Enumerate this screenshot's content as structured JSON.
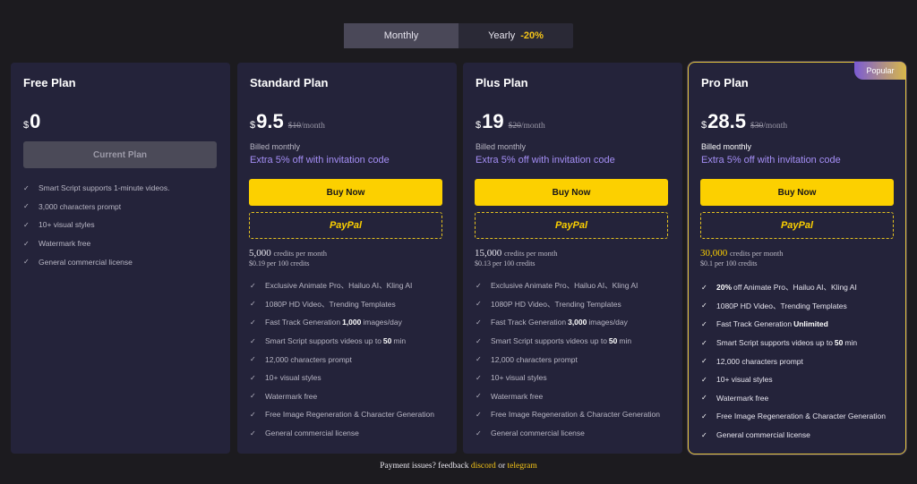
{
  "billing_toggle": {
    "monthly_label": "Monthly",
    "yearly_label": "Yearly",
    "yearly_discount": "-20%",
    "selected": "Monthly"
  },
  "currency_symbol": "$",
  "plans": [
    {
      "name": "Free Plan",
      "price": "0",
      "button_label": "Current Plan",
      "features": [
        "Smart Script supports 1-minute videos.",
        "3,000 characters prompt",
        "10+ visual styles",
        "Watermark free",
        "General commercial license"
      ]
    },
    {
      "name": "Standard Plan",
      "price": "9.5",
      "old_price": "$10",
      "old_period": "/month",
      "billed": "Billed monthly",
      "extra": "Extra 5% off with invitation code",
      "buy_label": "Buy Now",
      "paypal_label": "PayPal",
      "credits": "5,000",
      "credits_suffix": "credits per month",
      "credits_rate": "$0.19 per 100 credits",
      "features": {
        "f1": "Exclusive Animate Pro、Hailuo AI、Kling AI",
        "f2": "1080P HD Video、Trending Templates",
        "f3_pre": "Fast Track Generation",
        "f3_bold": "1,000",
        "f3_post": "images/day",
        "f4_pre": "Smart Script supports videos up to",
        "f4_bold": "50",
        "f4_post": "min",
        "f5": "12,000 characters prompt",
        "f6": "10+ visual styles",
        "f7": "Watermark free",
        "f8": "Free Image Regeneration & Character Generation",
        "f9": "General commercial license"
      }
    },
    {
      "name": "Plus Plan",
      "price": "19",
      "old_price": "$20",
      "old_period": "/month",
      "billed": "Billed monthly",
      "extra": "Extra 5% off with invitation code",
      "buy_label": "Buy Now",
      "paypal_label": "PayPal",
      "credits": "15,000",
      "credits_suffix": "credits per month",
      "credits_rate": "$0.13 per 100 credits",
      "features": {
        "f1": "Exclusive Animate Pro、Hailuo AI、Kling AI",
        "f2": "1080P HD Video、Trending Templates",
        "f3_pre": "Fast Track Generation",
        "f3_bold": "3,000",
        "f3_post": "images/day",
        "f4_pre": "Smart Script supports videos up to",
        "f4_bold": "50",
        "f4_post": "min",
        "f5": "12,000 characters prompt",
        "f6": "10+ visual styles",
        "f7": "Watermark free",
        "f8": "Free Image Regeneration & Character Generation",
        "f9": "General commercial license"
      }
    },
    {
      "name": "Pro Plan",
      "badge": "Popular",
      "price": "28.5",
      "old_price": "$30",
      "old_period": "/month",
      "billed": "Billed monthly",
      "extra": "Extra 5% off with invitation code",
      "buy_label": "Buy Now",
      "paypal_label": "PayPal",
      "credits": "30,000",
      "credits_suffix": "credits per month",
      "credits_rate": "$0.1 per 100 credits",
      "features": {
        "f1_bold": "20%",
        "f1_post": "off Animate Pro、Hailuo AI、Kling AI",
        "f2": "1080P HD Video、Trending Templates",
        "f3_pre": "Fast Track Generation",
        "f3_bold": "Unlimited",
        "f4_pre": "Smart Script supports videos up to",
        "f4_bold": "50",
        "f4_post": "min",
        "f5": "12,000 characters prompt",
        "f6": "10+ visual styles",
        "f7": "Watermark free",
        "f8": "Free Image Regeneration & Character Generation",
        "f9": "General commercial license"
      }
    }
  ],
  "footer": {
    "text": "Payment issues? feedback",
    "discord": "discord",
    "or": "or",
    "telegram": "telegram"
  },
  "colors": {
    "accent_yellow": "#fcd000",
    "accent_purple": "#a48ef5",
    "card_bg": "#24233a",
    "page_bg": "#1c1b1f"
  }
}
